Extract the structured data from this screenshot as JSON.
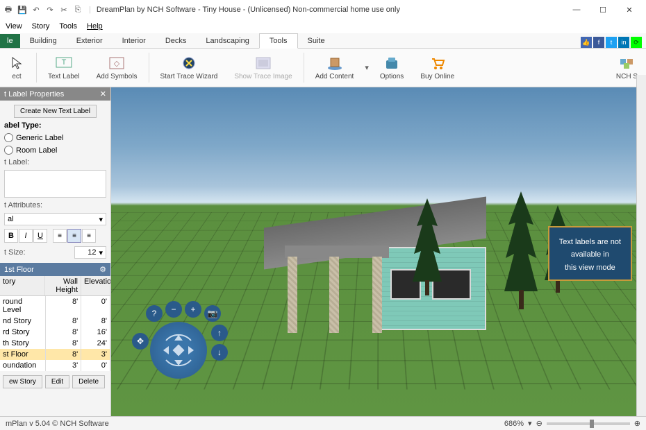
{
  "window": {
    "title": "DreamPlan by NCH Software - Tiny House - (Unlicensed) Non-commercial home use only"
  },
  "menus": {
    "view": "View",
    "story": "Story",
    "tools": "Tools",
    "help": "Help"
  },
  "tabs": {
    "file": "le",
    "building": "Building",
    "exterior": "Exterior",
    "interior": "Interior",
    "decks": "Decks",
    "landscaping": "Landscaping",
    "tools": "Tools",
    "suite": "Suite"
  },
  "ribbon": {
    "select": "ect",
    "textlabel": "Text Label",
    "addsymbols": "Add Symbols",
    "starttrace": "Start Trace Wizard",
    "showtrace": "Show Trace Image",
    "addcontent": "Add Content",
    "options": "Options",
    "buyonline": "Buy Online",
    "nch": "NCH S"
  },
  "panel": {
    "header": "t Label Properties",
    "create_btn": "Create New Text Label",
    "label_type": "abel Type:",
    "generic": "Generic Label",
    "room": "Room Label",
    "text_label": "t Label:",
    "text_attrs": "t Attributes:",
    "font": "al",
    "text_size": "t Size:",
    "size_val": "12"
  },
  "levels": {
    "header": "1st Floor",
    "cols": {
      "story": "tory",
      "wall": "Wall Height",
      "elev": "Elevation"
    },
    "rows": [
      {
        "n": "round Level",
        "w": "8'",
        "e": "0'"
      },
      {
        "n": "nd Story",
        "w": "8'",
        "e": "8'"
      },
      {
        "n": "rd Story",
        "w": "8'",
        "e": "16'"
      },
      {
        "n": "th Story",
        "w": "8'",
        "e": "24'"
      },
      {
        "n": "st Floor",
        "w": "8'",
        "e": "3'",
        "sel": true
      },
      {
        "n": "oundation",
        "w": "3'",
        "e": "0'"
      }
    ],
    "btns": {
      "new": "ew Story",
      "edit": "Edit",
      "delete": "Delete"
    }
  },
  "callout": "Text labels are not\navailable in\nthis view mode",
  "status": {
    "left": "mPlan v 5.04 © NCH Software",
    "zoom": "686%"
  }
}
